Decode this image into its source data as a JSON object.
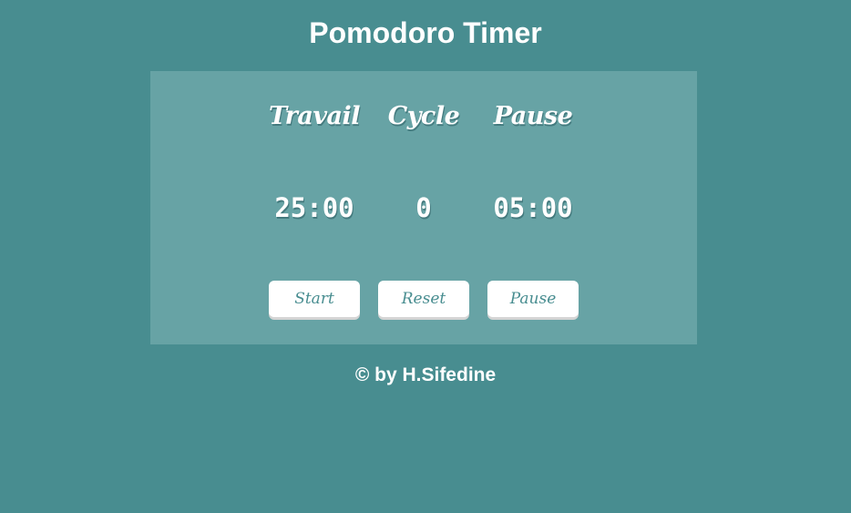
{
  "app": {
    "title": "Pomodoro Timer"
  },
  "timer": {
    "columns": [
      {
        "label": "Travail",
        "value": "25:00"
      },
      {
        "label": "Cycle",
        "value": "0"
      },
      {
        "label": "Pause",
        "value": "05:00"
      }
    ]
  },
  "controls": {
    "start_label": "Start",
    "reset_label": "Reset",
    "pause_label": "Pause"
  },
  "footer": {
    "credit": "© by H.Sifedine"
  },
  "colors": {
    "background": "#488d90",
    "panel": "#67a3a5",
    "text": "#ffffff",
    "button_bg": "#ffffff",
    "button_text": "#488d90"
  }
}
